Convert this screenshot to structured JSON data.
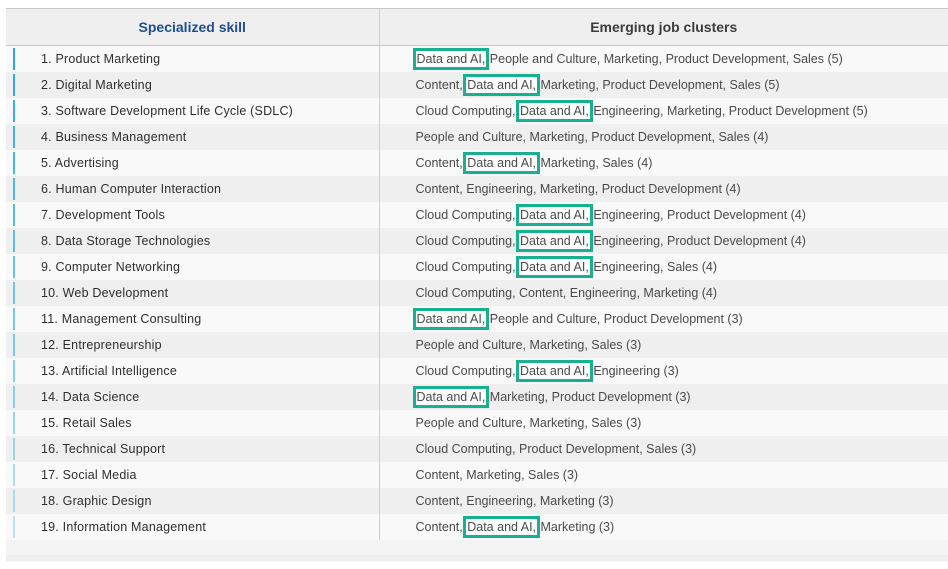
{
  "table": {
    "headers": {
      "skill": "Specialized skill",
      "clusters": "Emerging job clusters"
    },
    "colors": {
      "skill_header": "#1f4e8c",
      "highlight_border": "#18b08e",
      "row_accent": "#2aa7e0"
    },
    "rows": [
      {
        "skill": "1. Product Marketing",
        "pre": "",
        "highlight": "Data and AI,",
        "post": " People and Culture, Marketing, Product Development, Sales (5)"
      },
      {
        "skill": "2. Digital Marketing",
        "pre": "Content, ",
        "highlight": "Data and AI,",
        "post": " Marketing, Product Development, Sales (5)"
      },
      {
        "skill": "3. Software Development Life Cycle (SDLC)",
        "pre": "Cloud Computing, ",
        "highlight": "Data and AI,",
        "post": " Engineering, Marketing, Product Development (5)"
      },
      {
        "skill": "4. Business Management",
        "pre": "People and Culture, Marketing, Product Development, Sales (4)",
        "highlight": null,
        "post": ""
      },
      {
        "skill": "5. Advertising",
        "pre": "Content, ",
        "highlight": "Data and AI,",
        "post": " Marketing, Sales (4)"
      },
      {
        "skill": "6. Human Computer Interaction",
        "pre": "Content, Engineering, Marketing, Product Development (4)",
        "highlight": null,
        "post": ""
      },
      {
        "skill": "7. Development Tools",
        "pre": "Cloud Computing, ",
        "highlight": "Data and AI,",
        "post": " Engineering, Product Development (4)"
      },
      {
        "skill": "8. Data Storage Technologies",
        "pre": "Cloud Computing, ",
        "highlight": "Data and AI,",
        "post": " Engineering, Product Development (4)"
      },
      {
        "skill": "9. Computer Networking",
        "pre": "Cloud Computing, ",
        "highlight": "Data and AI,",
        "post": " Engineering, Sales (4)"
      },
      {
        "skill": "10. Web Development",
        "pre": "Cloud Computing, Content, Engineering, Marketing (4)",
        "highlight": null,
        "post": ""
      },
      {
        "skill": "11. Management Consulting",
        "pre": "",
        "highlight": "Data and AI,",
        "post": " People and Culture, Product Development (3)"
      },
      {
        "skill": "12. Entrepreneurship",
        "pre": "People and Culture, Marketing, Sales (3)",
        "highlight": null,
        "post": ""
      },
      {
        "skill": "13. Artificial Intelligence",
        "pre": "Cloud Computing, ",
        "highlight": "Data and AI,",
        "post": " Engineering (3)"
      },
      {
        "skill": "14. Data Science",
        "pre": "",
        "highlight": "Data and AI,",
        "post": " Marketing, Product Development (3)"
      },
      {
        "skill": "15. Retail Sales",
        "pre": "People and Culture, Marketing, Sales (3)",
        "highlight": null,
        "post": ""
      },
      {
        "skill": "16. Technical Support",
        "pre": "Cloud Computing, Product Development, Sales (3)",
        "highlight": null,
        "post": ""
      },
      {
        "skill": "17. Social Media",
        "pre": "Content, Marketing, Sales (3)",
        "highlight": null,
        "post": ""
      },
      {
        "skill": "18. Graphic Design",
        "pre": "Content, Engineering, Marketing (3)",
        "highlight": null,
        "post": ""
      },
      {
        "skill": "19. Information Management",
        "pre": "Content, ",
        "highlight": "Data and AI,",
        "post": " Marketing (3)"
      }
    ]
  }
}
